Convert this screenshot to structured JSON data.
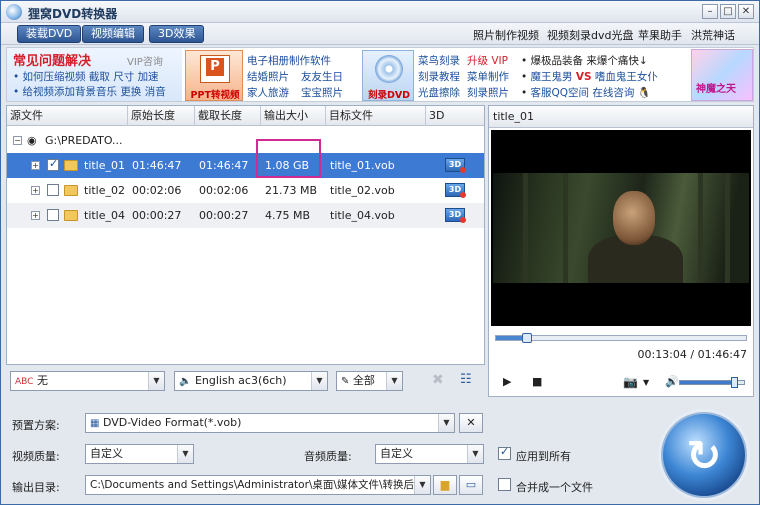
{
  "window": {
    "title": "狸窝DVD转换器"
  },
  "toolbar": {
    "buttons": [
      "装载DVD",
      "视频编辑",
      "3D效果"
    ],
    "links": [
      "照片制作视频",
      "视频刻录dvd光盘",
      "苹果助手",
      "洪荒神话"
    ]
  },
  "banner": {
    "faq_title": "常见问题解决",
    "vip": "VIP咨询",
    "faq_line1": [
      "如何压缩视频",
      "截取",
      "尺寸",
      "加速"
    ],
    "faq_line2": [
      "给视频添加背景音乐",
      "更换",
      "消音"
    ],
    "ppt_label": "PPT转视频",
    "col2": [
      "电子相册制作软件",
      "结婚照片",
      "友友生日",
      "家人旅游",
      "宝宝照片"
    ],
    "dvd_label": "刻录DVD",
    "col3_a": [
      "菜鸟刻录",
      "升级 VIP"
    ],
    "col3_b": [
      "刻录教程",
      "菜单制作"
    ],
    "col3_c": [
      "光盘擦除",
      "刻录照片"
    ],
    "col4_a": [
      "爆极品装备",
      "来爆个痛快↓"
    ],
    "col4_b": [
      "魔王鬼男",
      "VS",
      "嗜血鬼王女仆"
    ],
    "col4_c": [
      "客服QQ空间",
      "在线咨询"
    ],
    "game_text": "神魔之天"
  },
  "table": {
    "headers": [
      "源文件",
      "原始长度",
      "截取长度",
      "输出大小",
      "目标文件",
      "3D"
    ],
    "root": "G:\\PREDATO...",
    "rows": [
      {
        "name": "title_01",
        "orig": "01:46:47",
        "cut": "01:46:47",
        "size": "1.08 GB",
        "target": "title_01.vob",
        "checked": true
      },
      {
        "name": "title_02",
        "orig": "00:02:06",
        "cut": "00:02:06",
        "size": "21.73 MB",
        "target": "title_02.vob",
        "checked": false
      },
      {
        "name": "title_04",
        "orig": "00:00:27",
        "cut": "00:00:27",
        "size": "4.75 MB",
        "target": "title_04.vob",
        "checked": false
      }
    ]
  },
  "controls": {
    "subtitle": "无",
    "audio": "English ac3(6ch)",
    "scope": "全部"
  },
  "preview": {
    "title": "title_01",
    "time": "00:13:04 / 01:46:47",
    "progress": 0.122,
    "volume": 0.85
  },
  "settings": {
    "preset_label": "预置方案:",
    "preset_value": "DVD-Video Format(*.vob)",
    "video_quality_label": "视频质量:",
    "video_quality_value": "自定义",
    "audio_quality_label": "音频质量:",
    "audio_quality_value": "自定义",
    "apply_all_label": "应用到所有",
    "output_dir_label": "输出目录:",
    "output_dir_value": "C:\\Documents and Settings\\Administrator\\桌面\\媒体文件\\转换后",
    "merge_label": "合并成一个文件"
  }
}
